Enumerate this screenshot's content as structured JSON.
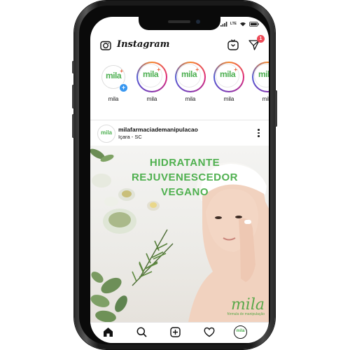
{
  "header": {
    "app_title": "Instagram",
    "dm_badge": "1",
    "icons": [
      "camera-icon",
      "igtv-icon",
      "direct-message-icon"
    ]
  },
  "status_bar": {
    "icons": [
      "bluetooth-icon",
      "signal-icon",
      "lte-icon",
      "wifi-icon",
      "battery-icon"
    ],
    "network": "LTE"
  },
  "stories": [
    {
      "name": "mila",
      "logo": "mila",
      "own": true
    },
    {
      "name": "mila",
      "logo": "mila",
      "own": false
    },
    {
      "name": "mila",
      "logo": "mila",
      "own": false
    },
    {
      "name": "mila",
      "logo": "mila",
      "own": false
    },
    {
      "name": "mila",
      "logo": "mila",
      "own": false
    }
  ],
  "post": {
    "username": "milafarmaciademanipulacao",
    "location": "Içara - SC",
    "avatar_text": "mila",
    "headline": [
      "HIDRATANTE",
      "REJUVENESCEDOR",
      "VEGANO"
    ],
    "watermark": "mila",
    "watermark_sub": "fórmula de manipulação"
  },
  "tabbar": {
    "items": [
      "home-icon",
      "search-icon",
      "new-post-icon",
      "activity-heart-icon",
      "profile-icon"
    ],
    "profile_text": "mila"
  },
  "colors": {
    "brand_green": "#4fb04f",
    "badge_red": "#ed4956",
    "add_blue": "#3897f0"
  }
}
